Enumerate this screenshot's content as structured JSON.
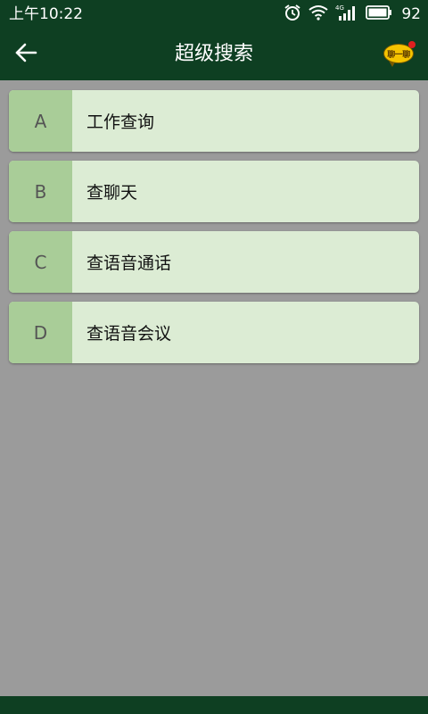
{
  "status_bar": {
    "time": "上午10:22",
    "network": "4G",
    "battery": "92"
  },
  "header": {
    "title": "超级搜索",
    "chat_badge": "聊一聊"
  },
  "options": [
    {
      "letter": "A",
      "label": "工作查询"
    },
    {
      "letter": "B",
      "label": "查聊天"
    },
    {
      "letter": "C",
      "label": "查语音通话"
    },
    {
      "letter": "D",
      "label": "查语音会议"
    }
  ],
  "colors": {
    "header_bg": "#0e3f22",
    "page_bg": "#9b9b9b",
    "card_bg": "#dcecd4",
    "letter_bg": "#a9cd98"
  }
}
